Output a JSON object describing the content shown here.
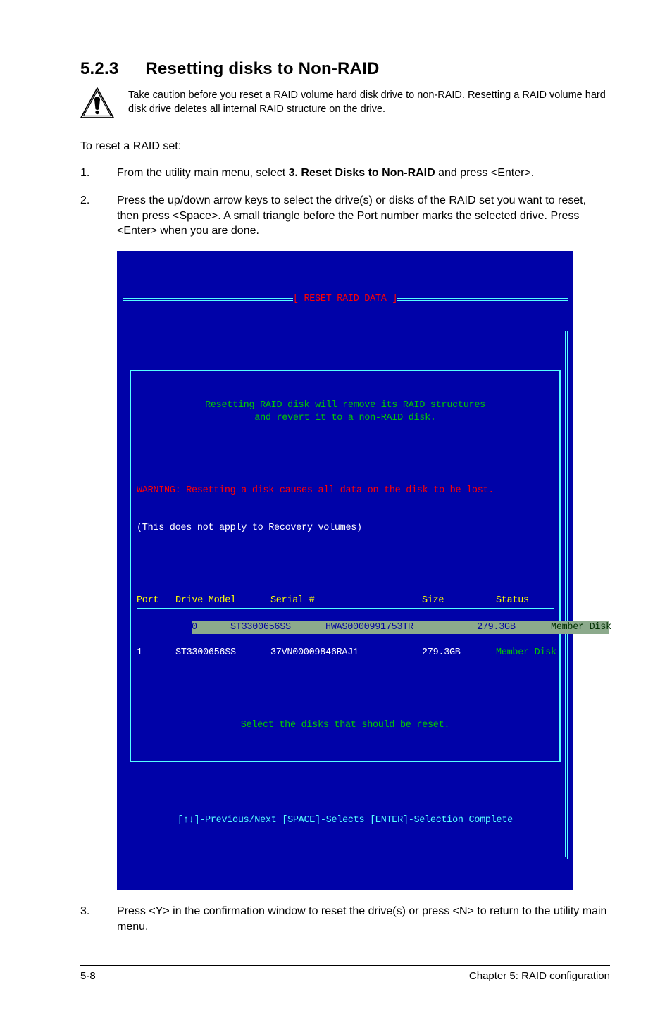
{
  "heading": {
    "number": "5.2.3",
    "title": "Resetting disks to Non-RAID"
  },
  "caution_icon_name": "caution-icon",
  "caution_text": "Take caution before you reset a RAID volume hard disk drive to non-RAID. Resetting a RAID volume hard disk drive deletes all internal RAID structure on the drive.",
  "intro": "To reset a RAID set:",
  "steps": [
    {
      "num": "1.",
      "prefix": "From the utility main menu, select ",
      "bold": "3. Reset Disks to Non-RAID",
      "suffix": " and press <Enter>."
    },
    {
      "num": "2.",
      "text": "Press the up/down arrow keys to select the drive(s) or disks of the RAID set you want to reset, then press <Space>. A small triangle before the Port number marks the selected drive. Press <Enter> when you are done."
    },
    {
      "num": "3.",
      "text": "Press <Y> in the confirmation window to reset the drive(s) or press <N> to return to the utility main menu."
    }
  ],
  "bios": {
    "title": "[ RESET RAID DATA ]",
    "msg1": "Resetting RAID disk will remove its RAID structures",
    "msg2": "and revert it to a non-RAID disk.",
    "warn_label": "WARNING: ",
    "warn_text": "Resetting a disk causes all data on the disk to be lost.",
    "recovery_note": "(This does not apply to Recovery volumes)",
    "headers": {
      "port": "Port",
      "model": "Drive Model",
      "serial": "Serial #",
      "size": "Size",
      "status": "Status"
    },
    "rows": [
      {
        "port": "0",
        "model": "ST3300656SS",
        "serial": "HWAS0000991753TR",
        "size": "279.3GB",
        "status": "Member Disk",
        "highlight": true
      },
      {
        "port": "1",
        "model": "ST3300656SS",
        "serial": "37VN00009846RAJ1",
        "size": "279.3GB",
        "status": "Member Disk",
        "highlight": false
      }
    ],
    "select_msg": "Select the disks that should be reset.",
    "footer_nav": "[↑↓]-Previous/Next [SPACE]-Selects [ENTER]-Selection Complete"
  },
  "chart_data": {
    "type": "table",
    "title": "RESET RAID DATA",
    "columns": [
      "Port",
      "Drive Model",
      "Serial #",
      "Size",
      "Status"
    ],
    "rows": [
      [
        "0",
        "ST3300656SS",
        "HWAS0000991753TR",
        "279.3GB",
        "Member Disk"
      ],
      [
        "1",
        "ST3300656SS",
        "37VN00009846RAJ1",
        "279.3GB",
        "Member Disk"
      ]
    ]
  },
  "footer": {
    "left": "5-8",
    "right": "Chapter 5: RAID configuration"
  }
}
